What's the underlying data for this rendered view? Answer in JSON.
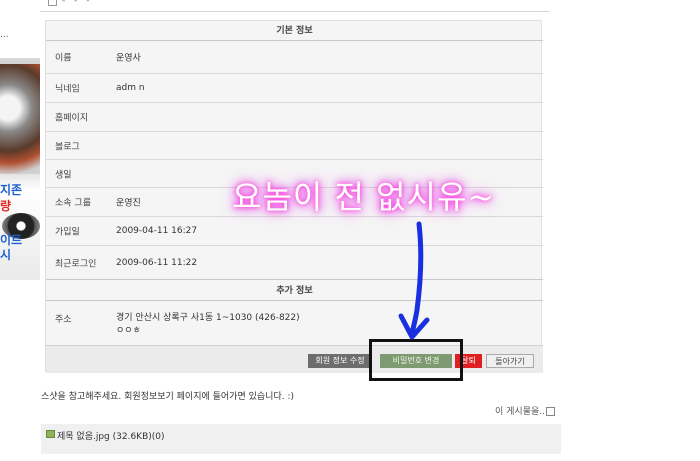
{
  "left": {
    "dots": "...",
    "ad_lines": [
      "지존",
      "량",
      "이트",
      "시"
    ]
  },
  "panel": {
    "section_basic": "기본 정보",
    "section_extra": "추가 정보",
    "rows": [
      {
        "label": "이름",
        "value": "운영사"
      },
      {
        "label": "닉네임",
        "value": "adm n"
      },
      {
        "label": "홈페이지",
        "value": ""
      },
      {
        "label": "블로그",
        "value": ""
      },
      {
        "label": "생일",
        "value": ""
      },
      {
        "label": "소속 그룹",
        "value": "운영진"
      },
      {
        "label": "가입일",
        "value": "2009-04-11 16:27"
      },
      {
        "label": "최근로그인",
        "value": "2009-06-11 11:22"
      }
    ],
    "address": {
      "label": "주소",
      "line1": "경기 안산시 상록구 사1동 1~1030 (426-822)",
      "line2": "ㅇㅇㅎ"
    },
    "buttons": {
      "edit_info": "회원 정보 수정",
      "change_password": "비밀번호 변경",
      "withdraw": "탈퇴",
      "back": "돌아가기"
    }
  },
  "annotation": {
    "text": "요놈이 전 없시유~",
    "arrow_color": "#1a2fe0"
  },
  "footer": {
    "caption": "스샷을 참고해주세요. 회원정보보기 페이지에 들어가면 있습니다. :)",
    "more_posts": "이 게시물을..",
    "attachment": "제목 없음.jpg (32.6KB)(0)"
  }
}
